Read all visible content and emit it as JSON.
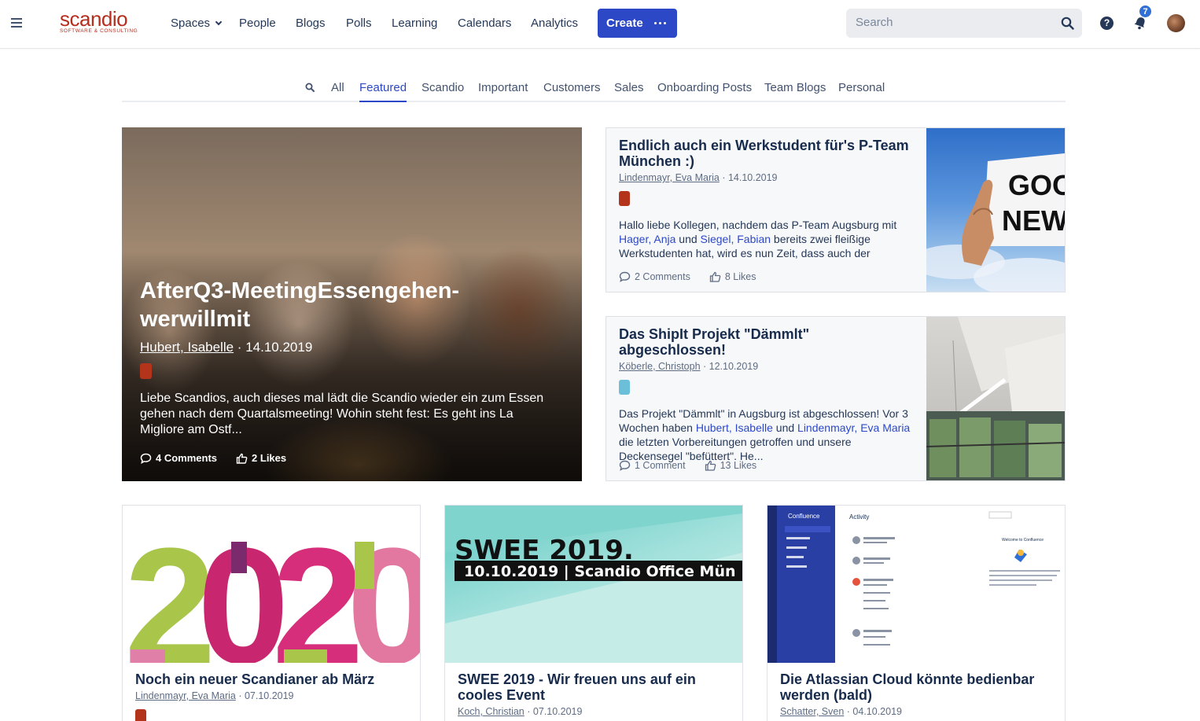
{
  "nav": {
    "logo_main": "scandio",
    "logo_sub": "SOFTWARE & CONSULTING",
    "items": [
      "Spaces",
      "People",
      "Blogs",
      "Polls",
      "Learning",
      "Calendars",
      "Analytics"
    ],
    "create_label": "Create",
    "search_placeholder": "Search",
    "help_label": "?",
    "notification_count": "7"
  },
  "tabs": [
    "All",
    "Featured",
    "Scandio",
    "Important",
    "Customers",
    "Sales",
    "Onboarding Posts",
    "Team Blogs",
    "Personal"
  ],
  "active_tab": "Featured",
  "hero": {
    "title": "AfterQ3-MeetingEssengehen-werwillmit",
    "author": "Hubert, Isabelle",
    "date": "14.10.2019",
    "tag_color": "#b3331b",
    "excerpt": "Liebe Scandios, auch dieses mal lädt die Scandio wieder ein zum Essen gehen nach dem Quartalsmeeting! Wohin steht fest: Es geht ins La Migliore am Ostf...",
    "comments": "4 Comments",
    "likes": "2 Likes"
  },
  "side_cards": [
    {
      "title": "Endlich auch ein Werkstudent für's P-Team München :)",
      "author": "Lindenmayr, Eva Maria",
      "date": "14.10.2019",
      "tag_color": "#b3331b",
      "excerpt_1": "Hallo liebe Kollegen, nachdem das P-Team Augsburg mit ",
      "link_1": "Hager, Anja",
      "excerpt_2": " und ",
      "link_2": "Siegel, Fabian",
      "excerpt_3": " bereits zwei fleißige Werkstudenten hat, wird es nun Zeit, dass auch der Münchener Teil des...",
      "comments": "2 Comments",
      "likes": "8 Likes",
      "image_text_1": "GOO",
      "image_text_2": "NEW"
    },
    {
      "title": "Das ShipIt Projekt \"Dämmlt\" abgeschlossen!",
      "author": "Köberle, Christoph",
      "date": "12.10.2019",
      "tag_color": "#6bbfd8",
      "excerpt_1": "Das Projekt \"Dämmlt\" in Augsburg ist abgeschlossen! Vor 3 Wochen haben ",
      "link_1": "Hubert, Isabelle",
      "excerpt_2": " und ",
      "link_2": "Lindenmayr, Eva Maria",
      "excerpt_3": " die letzten Vorbereitungen getroffen und unsere Deckensegel \"befüttert\". He...",
      "comments": "1 Comment",
      "likes": "13 Likes"
    }
  ],
  "bottom_cards": [
    {
      "title": "Noch ein neuer Scandianer ab März",
      "author": "Lindenmayr, Eva Maria",
      "date": "07.10.2019",
      "tag_color": "#b3331b",
      "image_digits": [
        "2",
        "0",
        "2",
        "0"
      ]
    },
    {
      "title": "SWEE 2019 - Wir freuen uns auf ein cooles Event",
      "author": "Koch, Christian",
      "date": "07.10.2019",
      "image_line_1": "SWEE 2019.",
      "image_line_2": "10.10.2019 | Scandio Office Mün"
    },
    {
      "title": "Die Atlassian Cloud könnte bedienbar werden (bald)",
      "author": "Schatter, Sven",
      "date": "04.10.2019",
      "image_app": "Confluence",
      "image_heading": "Activity",
      "image_welcome": "Welcome to Confluence"
    }
  ],
  "colors": {
    "accent": "#2c48c6",
    "brand": "#b52e1e",
    "text": "#172b4d"
  }
}
